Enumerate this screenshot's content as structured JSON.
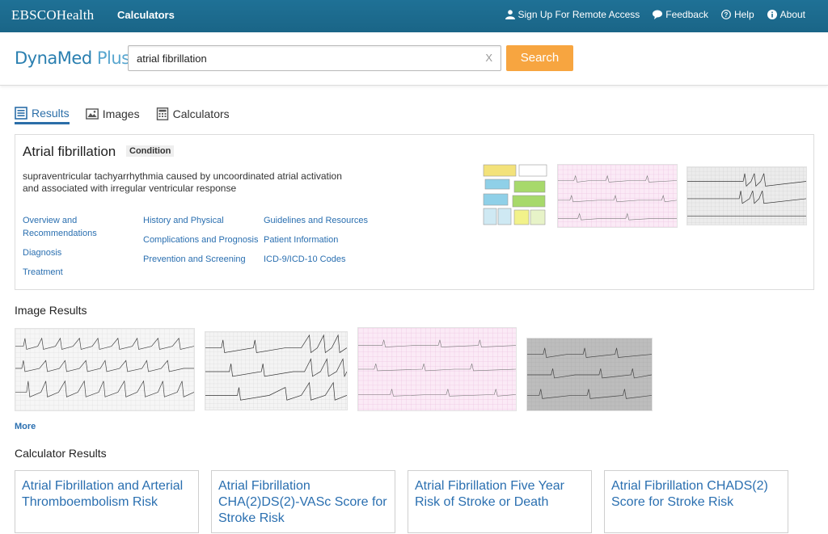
{
  "topbar": {
    "brand_a": "EBSCO",
    "brand_b": "Health",
    "nav_calculators": "Calculators",
    "links": [
      {
        "label": "Sign Up For Remote Access",
        "icon": "user-icon"
      },
      {
        "label": "Feedback",
        "icon": "speech-bubble-icon"
      },
      {
        "label": "Help",
        "icon": "question-circle-icon"
      },
      {
        "label": "About",
        "icon": "info-circle-icon"
      }
    ]
  },
  "header": {
    "logo_a": "DynaMed",
    "logo_b": " Plus",
    "search_value": "atrial fibrillation",
    "clear_label": "X",
    "search_button": "Search"
  },
  "tabs": [
    {
      "label": "Results",
      "icon": "list-icon",
      "active": true
    },
    {
      "label": "Images",
      "icon": "image-icon",
      "active": false
    },
    {
      "label": "Calculators",
      "icon": "calculator-icon",
      "active": false
    }
  ],
  "topic": {
    "title": "Atrial fibrillation",
    "badge": "Condition",
    "description": "supraventricular tachyarrhythmia caused by uncoordinated atrial activation and associated with irregular ventricular response",
    "links_col1": [
      "Overview and",
      "Recommendations",
      "Diagnosis",
      "Treatment"
    ],
    "links_col2": [
      "History and Physical",
      "Complications and Prognosis",
      "Prevention and Screening"
    ],
    "links_col3": [
      "Guidelines and Resources",
      "Patient Information",
      "ICD-9/ICD-10 Codes"
    ]
  },
  "image_results": {
    "heading": "Image Results",
    "more": "More"
  },
  "calculator_results": {
    "heading": "Calculator Results",
    "cards": [
      "Atrial Fibrillation and Arterial Thromboembolism Risk",
      "Atrial Fibrillation CHA(2)DS(2)-VASc Score for Stroke Risk",
      "Atrial Fibrillation Five Year Risk of Stroke or Death",
      "Atrial Fibrillation CHADS(2) Score for Stroke Risk"
    ]
  },
  "colors": {
    "topbar": "#1d6c8f",
    "link": "#2a6fb0",
    "search_button": "#f7a540"
  }
}
